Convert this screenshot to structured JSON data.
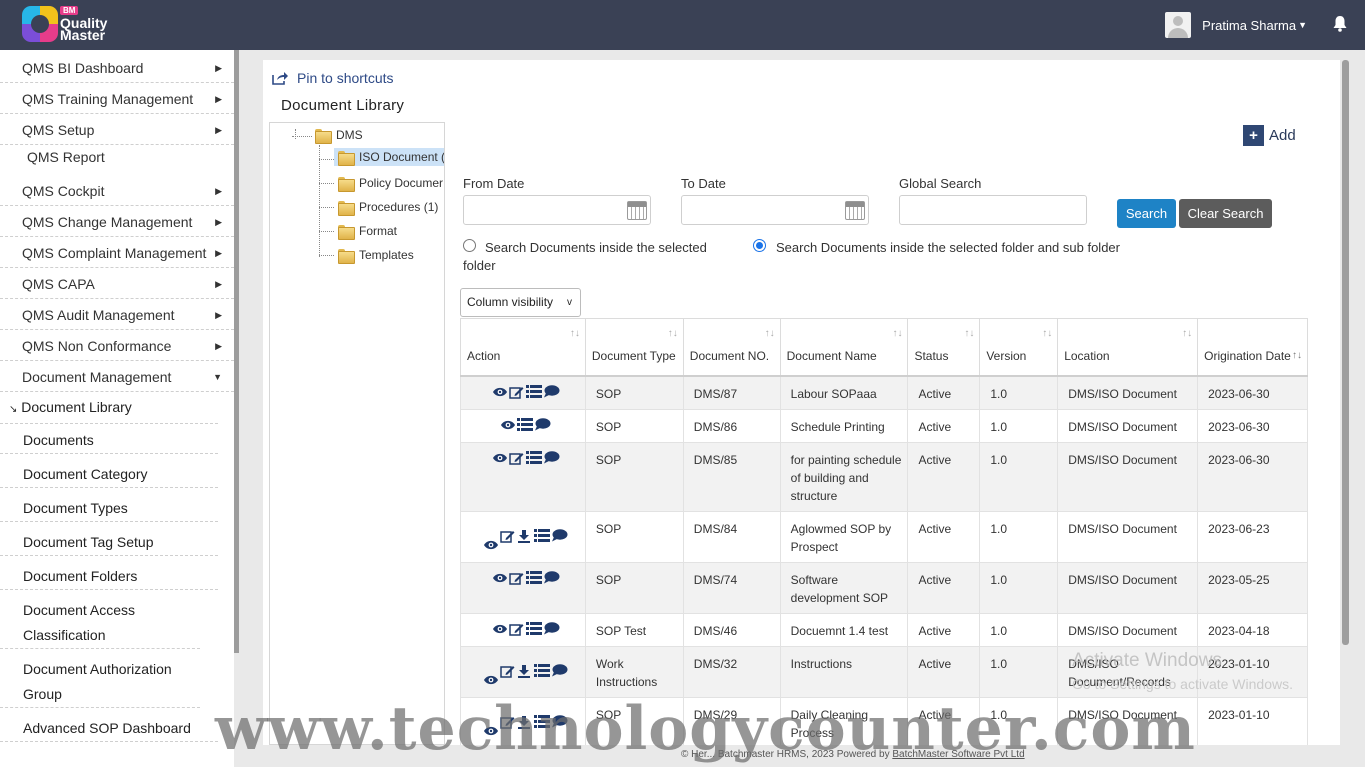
{
  "app": {
    "logo_badge": "BM",
    "logo_line1": "Quality",
    "logo_line2": "Master"
  },
  "header": {
    "user_name": "Pratima Sharma"
  },
  "sidebar": {
    "menus": [
      "QMS BI Dashboard",
      "QMS Training Management",
      "QMS Setup",
      "QMS Report",
      "QMS Cockpit",
      "QMS Change Management",
      "QMS Complaint Management",
      "QMS CAPA",
      "QMS Audit Management",
      "QMS Non Conformance",
      "Document Management"
    ],
    "sub_items": [
      "Document Library",
      "Documents",
      "Document Category",
      "Document Types",
      "Document Tag Setup",
      "Document Folders",
      "Document Access Classification",
      "Document Authorization Group",
      "Advanced SOP Dashboard"
    ]
  },
  "page": {
    "pin_label": "Pin to shortcuts",
    "title": "Document Library",
    "add_label": "Add"
  },
  "tree": {
    "root": "DMS",
    "children": [
      "ISO Document (",
      "Policy Documer",
      "Procedures (1)",
      "Format",
      "Templates"
    ]
  },
  "filters": {
    "from_label": "From Date",
    "to_label": "To Date",
    "global_label": "Global Search",
    "search_btn": "Search",
    "clear_btn": "Clear Search",
    "radio1": "Search Documents inside the selected folder",
    "radio2": "Search Documents inside the selected folder and sub folder",
    "column_visibility": "Column visibility"
  },
  "table": {
    "headers": [
      "Action",
      "Document Type",
      "Document NO.",
      "Document Name",
      "Status",
      "Version",
      "Location",
      "Origination Date"
    ],
    "rows": [
      {
        "type": "SOP",
        "no": "DMS/87",
        "name": "Labour SOPaaa",
        "status": "Active",
        "version": "1.0",
        "location": "DMS/ISO Document",
        "date": "2023-06-30"
      },
      {
        "type": "SOP",
        "no": "DMS/86",
        "name": "Schedule Printing",
        "status": "Active",
        "version": "1.0",
        "location": "DMS/ISO Document",
        "date": "2023-06-30"
      },
      {
        "type": "SOP",
        "no": "DMS/85",
        "name": "for painting schedule of building and structure",
        "status": "Active",
        "version": "1.0",
        "location": "DMS/ISO Document",
        "date": "2023-06-30"
      },
      {
        "type": "SOP",
        "no": "DMS/84",
        "name": "Aglowmed SOP by Prospect",
        "status": "Active",
        "version": "1.0",
        "location": "DMS/ISO Document",
        "date": "2023-06-23"
      },
      {
        "type": "SOP",
        "no": "DMS/74",
        "name": "Software development SOP",
        "status": "Active",
        "version": "1.0",
        "location": "DMS/ISO Document",
        "date": "2023-05-25"
      },
      {
        "type": "SOP Test",
        "no": "DMS/46",
        "name": "Docuemnt 1.4 test",
        "status": "Active",
        "version": "1.0",
        "location": "DMS/ISO Document",
        "date": "2023-04-18"
      },
      {
        "type": "Work Instructions",
        "no": "DMS/32",
        "name": "Instructions",
        "status": "Active",
        "version": "1.0",
        "location": "DMS/ISO Document/Records",
        "date": "2023-01-10"
      },
      {
        "type": "SOP",
        "no": "DMS/29",
        "name": "Daily Cleaning Process",
        "status": "Active",
        "version": "1.0",
        "location": "DMS/ISO Document",
        "date": "2023-01-10"
      }
    ]
  },
  "footer": {
    "text": "© Her... Batchmaster HRMS, 2023  Powered by ",
    "link": "BatchMaster Software Pvt Ltd"
  },
  "overlay": {
    "activate_title": "Activate Windows",
    "activate_sub": "Go to Settings to activate Windows.",
    "watermark": "www.technologycounter.com"
  },
  "colors": {
    "header_bg": "#3a4155",
    "search_btn": "#1e83c6",
    "clear_btn": "#5c5c5c",
    "link": "#2e4a86"
  }
}
